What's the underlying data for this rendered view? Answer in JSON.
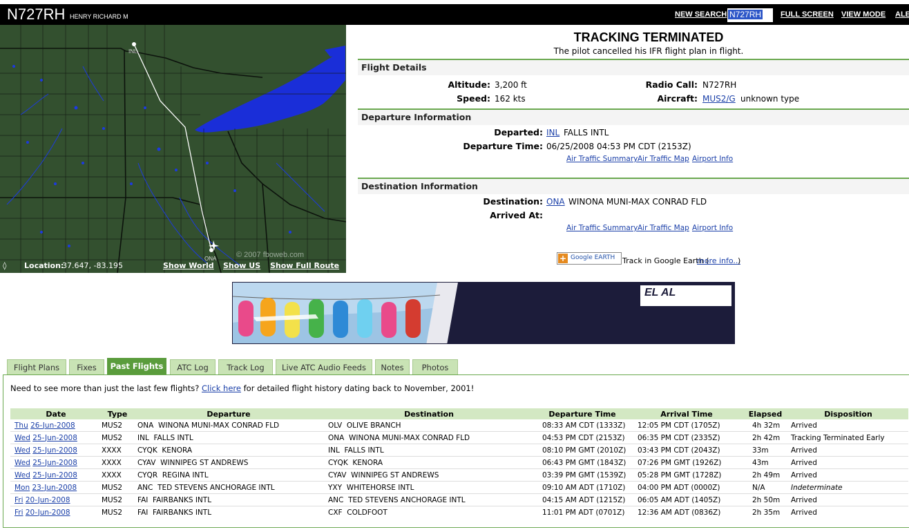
{
  "header": {
    "tail_number": "N727RH",
    "owner": "HENRY RICHARD M",
    "new_search_label": "NEW SEARCH",
    "search_value": "N727RH",
    "full_screen_label": "FULL SCREEN",
    "view_mode_label": "VIEW MODE",
    "alerts_label": "ALE"
  },
  "map": {
    "origin_label": "INL",
    "dest_label": "ONA",
    "watermark": "© 2007 fboweb.com",
    "location_label": "Location:",
    "location_value": "37.647, -83.195",
    "show_world": "Show World",
    "show_us": "Show US",
    "show_full_route": "Show Full Route"
  },
  "status": {
    "title": "TRACKING TERMINATED",
    "subtitle": "The pilot cancelled his IFR flight plan in flight."
  },
  "flight_details": {
    "heading": "Flight Details",
    "altitude_label": "Altitude:",
    "altitude_value": "3,200 ft",
    "speed_label": "Speed:",
    "speed_value": "162 kts",
    "radio_label": "Radio Call:",
    "radio_value": "N727RH",
    "aircraft_label": "Aircraft:",
    "aircraft_code": "MUS2/G",
    "aircraft_type": "unknown type"
  },
  "departure": {
    "heading": "Departure Information",
    "departed_label": "Departed:",
    "airport_code": "INL",
    "airport_name": "FALLS INTL",
    "time_label": "Departure Time:",
    "time_value": "06/25/2008 04:53 PM CDT (2153Z)",
    "link_summary": "Air Traffic Summary",
    "link_map": "Air Traffic Map",
    "link_info": "Airport Info"
  },
  "destination": {
    "heading": "Destination Information",
    "dest_label": "Destination:",
    "airport_code": "ONA",
    "airport_name": "WINONA MUNI-MAX CONRAD FLD",
    "arrived_label": "Arrived At:",
    "link_summary": "Air Traffic Summary",
    "link_map": "Air Traffic Map",
    "link_info": "Airport Info"
  },
  "google_earth": {
    "badge_text": "Google EARTH",
    "text": "Track in Google Earth (",
    "more_info": "more info...",
    "close_paren": ")"
  },
  "banner": {
    "brand": "EL AL"
  },
  "tabs": [
    {
      "label": "Flight Plans",
      "active": false
    },
    {
      "label": "Fixes",
      "active": false
    },
    {
      "label": "Past Flights",
      "active": true
    },
    {
      "label": "ATC Log",
      "active": false
    },
    {
      "label": "Track Log",
      "active": false
    },
    {
      "label": "Live ATC Audio Feeds",
      "active": false
    },
    {
      "label": "Notes",
      "active": false
    },
    {
      "label": "Photos",
      "active": false
    }
  ],
  "past_flights": {
    "intro_before": "Need to see more than just the last few flights?",
    "intro_link": "Click here",
    "intro_after": "for detailed flight history dating back to November, 2001!",
    "columns": [
      "Date",
      "Type",
      "Departure",
      "Destination",
      "Departure Time",
      "Arrival Time",
      "Elapsed",
      "Disposition"
    ],
    "rows": [
      {
        "day": "Thu",
        "date": "26-Jun-2008",
        "type": "MUS2",
        "dep_code": "ONA",
        "dep_name": "WINONA MUNI-MAX CONRAD FLD",
        "dst_code": "OLV",
        "dst_name": "OLIVE BRANCH",
        "dep_time": "08:33 AM CDT (1333Z)",
        "arr_time": "12:05 PM CDT (1705Z)",
        "elapsed": "4h 32m",
        "disposition": "Arrived",
        "italic": false
      },
      {
        "day": "Wed",
        "date": "25-Jun-2008",
        "type": "MUS2",
        "dep_code": "INL",
        "dep_name": "FALLS INTL",
        "dst_code": "ONA",
        "dst_name": "WINONA MUNI-MAX CONRAD FLD",
        "dep_time": "04:53 PM CDT (2153Z)",
        "arr_time": "06:35 PM CDT (2335Z)",
        "elapsed": "2h 42m",
        "disposition": "Tracking Terminated Early",
        "italic": false
      },
      {
        "day": "Wed",
        "date": "25-Jun-2008",
        "type": "XXXX",
        "dep_code": "CYQK",
        "dep_name": "KENORA",
        "dst_code": "INL",
        "dst_name": "FALLS INTL",
        "dep_time": "08:10 PM GMT (2010Z)",
        "arr_time": "03:43 PM CDT (2043Z)",
        "elapsed": "33m",
        "disposition": "Arrived",
        "italic": false
      },
      {
        "day": "Wed",
        "date": "25-Jun-2008",
        "type": "XXXX",
        "dep_code": "CYAV",
        "dep_name": "WINNIPEG ST ANDREWS",
        "dst_code": "CYQK",
        "dst_name": "KENORA",
        "dep_time": "06:43 PM GMT (1843Z)",
        "arr_time": "07:26 PM GMT (1926Z)",
        "elapsed": "43m",
        "disposition": "Arrived",
        "italic": false
      },
      {
        "day": "Wed",
        "date": "25-Jun-2008",
        "type": "XXXX",
        "dep_code": "CYQR",
        "dep_name": "REGINA INTL",
        "dst_code": "CYAV",
        "dst_name": "WINNIPEG ST ANDREWS",
        "dep_time": "03:39 PM GMT (1539Z)",
        "arr_time": "05:28 PM GMT (1728Z)",
        "elapsed": "2h 49m",
        "disposition": "Arrived",
        "italic": false
      },
      {
        "day": "Mon",
        "date": "23-Jun-2008",
        "type": "MUS2",
        "dep_code": "ANC",
        "dep_name": "TED STEVENS ANCHORAGE INTL",
        "dst_code": "YXY",
        "dst_name": "WHITEHORSE INTL",
        "dep_time": "09:10 AM ADT (1710Z)",
        "arr_time": "04:00 PM ADT (0000Z)",
        "elapsed": "N/A",
        "disposition": "Indeterminate",
        "italic": true
      },
      {
        "day": "Fri",
        "date": "20-Jun-2008",
        "type": "MUS2",
        "dep_code": "FAI",
        "dep_name": "FAIRBANKS INTL",
        "dst_code": "ANC",
        "dst_name": "TED STEVENS ANCHORAGE INTL",
        "dep_time": "04:15 AM ADT (1215Z)",
        "arr_time": "06:05 AM ADT (1405Z)",
        "elapsed": "2h 50m",
        "disposition": "Arrived",
        "italic": false
      },
      {
        "day": "Fri",
        "date": "20-Jun-2008",
        "type": "MUS2",
        "dep_code": "FAI",
        "dep_name": "FAIRBANKS INTL",
        "dst_code": "CXF",
        "dst_name": "COLDFOOT",
        "dep_time": "11:01 PM ADT (0701Z)",
        "arr_time": "12:36 AM ADT (0836Z)",
        "elapsed": "2h 35m",
        "disposition": "Arrived",
        "italic": false
      }
    ]
  }
}
